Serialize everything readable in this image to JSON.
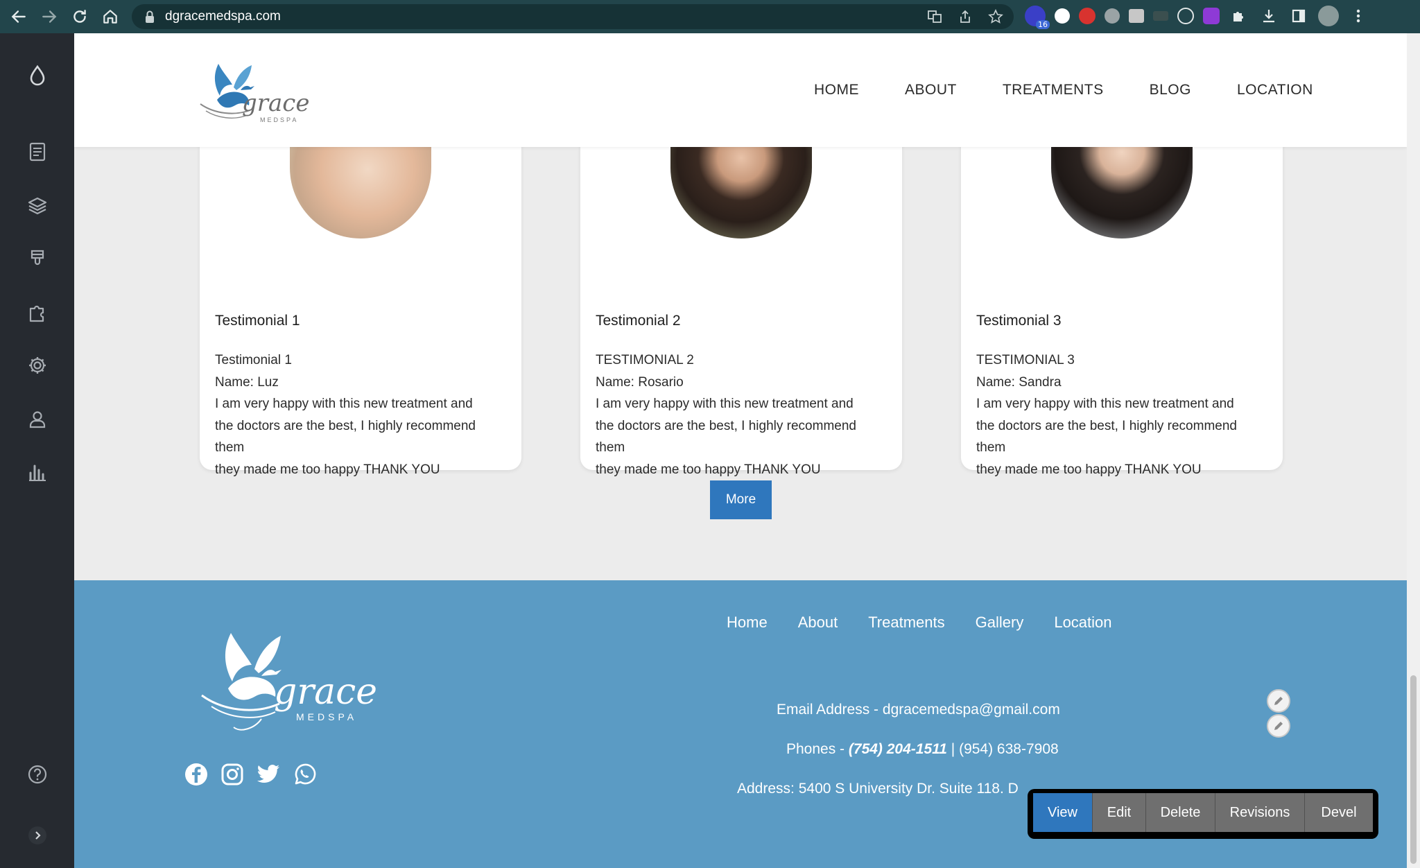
{
  "browser": {
    "url": "dgracemedspa.com",
    "extension_badge": "16"
  },
  "header": {
    "nav": [
      "HOME",
      "ABOUT",
      "TREATMENTS",
      "BLOG",
      "LOCATION"
    ]
  },
  "testimonials": [
    {
      "title": "Testimonial 1",
      "lines": [
        "Testimonial 1",
        "Name: Luz",
        "I am very happy with this new treatment and",
        "the doctors are the best, I highly recommend",
        "them",
        "they made me too happy THANK YOU"
      ]
    },
    {
      "title": "Testimonial 2",
      "lines": [
        "TESTIMONIAL 2",
        "Name: Rosario",
        "I am very happy with this new treatment and",
        "the doctors are the best, I highly recommend",
        "them",
        "they made me too happy THANK YOU"
      ]
    },
    {
      "title": "Testimonial 3",
      "lines": [
        "TESTIMONIAL 3",
        "Name: Sandra",
        "I am very happy with this new treatment and",
        "the doctors are the best, I highly recommend",
        "them",
        "they made me too happy THANK YOU"
      ]
    }
  ],
  "more_label": "More",
  "footer": {
    "nav": [
      "Home",
      "About",
      "Treatments",
      "Gallery",
      "Location"
    ],
    "email": "Email Address - dgracemedspa@gmail.com",
    "phones_prefix": "Phones - ",
    "phone_primary": "(754) 204-1511",
    "phone_sep": " | ",
    "phone_secondary": "(954) 638-7908",
    "address": "Address:  5400 S University Dr. Suite 118. D"
  },
  "admin_tabs": [
    "View",
    "Edit",
    "Delete",
    "Revisions",
    "Devel"
  ],
  "colors": {
    "chrome_bg": "#22454b",
    "sidebar_bg": "#262a30",
    "brand_blue": "#2f77bd",
    "footer_bg": "#5b9bc4"
  },
  "icons": {
    "sidebar": [
      "drop-icon",
      "document-icon",
      "layers-icon",
      "brush-icon",
      "puzzle-icon",
      "gear-icon",
      "user-icon",
      "bar-chart-icon",
      "help-icon",
      "chevron-right-icon"
    ],
    "socials": [
      "facebook-icon",
      "instagram-icon",
      "twitter-icon",
      "whatsapp-icon"
    ]
  }
}
